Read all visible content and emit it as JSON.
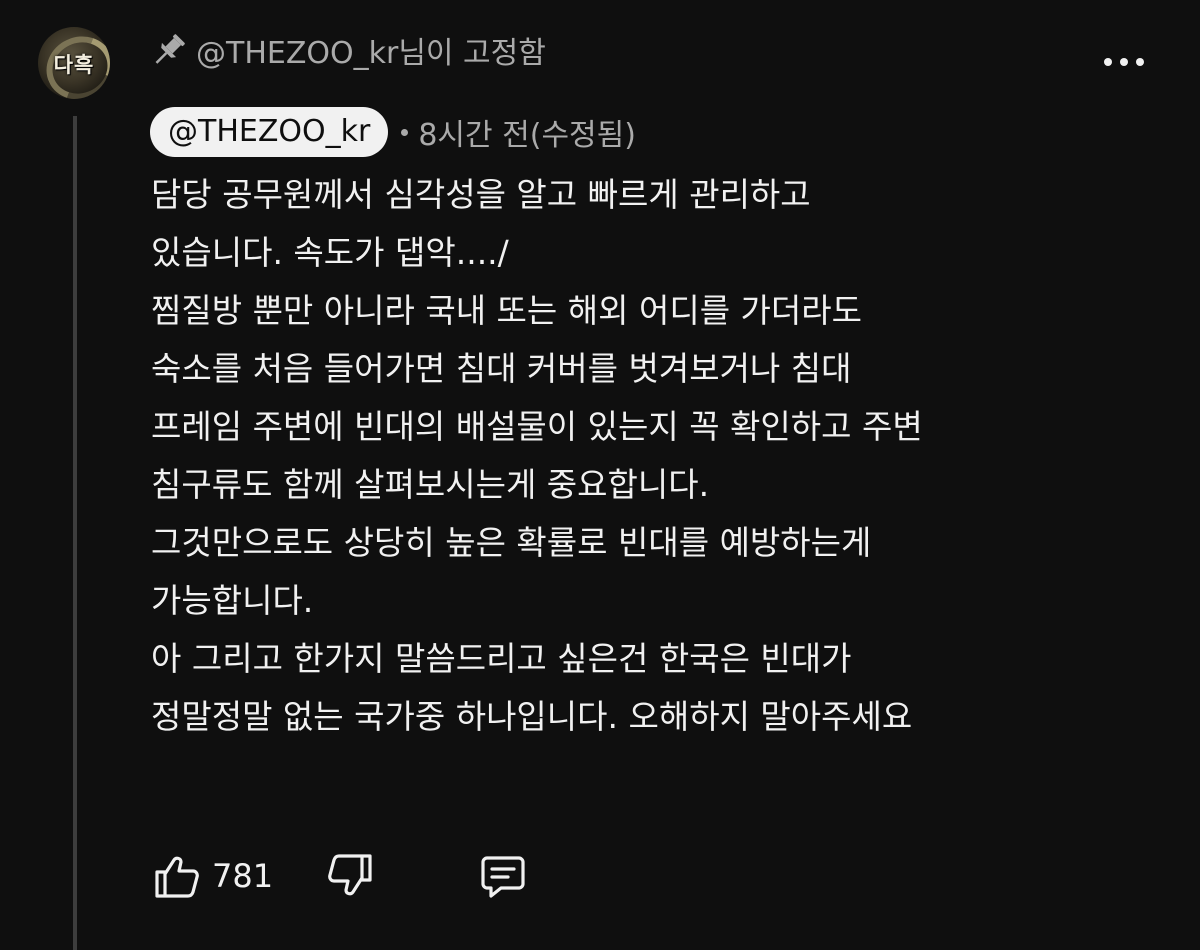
{
  "channel": {
    "avatar_text": "다흑",
    "pinned_by": "@THEZOO_kr님이 고정함"
  },
  "comment": {
    "author": "@THEZOO_kr",
    "timestamp": "8시간 전(수정됨)",
    "lines": [
      "담당 공무원께서 심각성을 알고 빠르게 관리하고",
      "있습니다. 속도가 댑악..../",
      "찜질방 뿐만 아니라 국내 또는 해외 어디를 가더라도",
      "숙소를 처음 들어가면 침대 커버를 벗겨보거나 침대",
      "프레임 주변에 빈대의 배설물이 있는지 꼭 확인하고 주변",
      "침구류도 함께 살펴보시는게 중요합니다.",
      "그것만으로도 상당히 높은 확률로 빈대를 예방하는게",
      "가능합니다.",
      "아 그리고 한가지 말씀드리고 싶은건 한국은 빈대가",
      "정말정말 없는 국가중 하나입니다. 오해하지 말아주세요"
    ]
  },
  "actions": {
    "like_count": "781"
  },
  "icons": {
    "pin": "pin-icon",
    "more": "more-vert-icon",
    "like": "thumbs-up-icon",
    "dislike": "thumbs-down-icon",
    "reply": "comment-icon"
  },
  "colors": {
    "background": "#0f0f0f",
    "text_primary": "#f1f1f1",
    "text_secondary": "#aaaaaa",
    "author_chip": "#f1f1f1",
    "thread_line": "#3d3d3d"
  }
}
